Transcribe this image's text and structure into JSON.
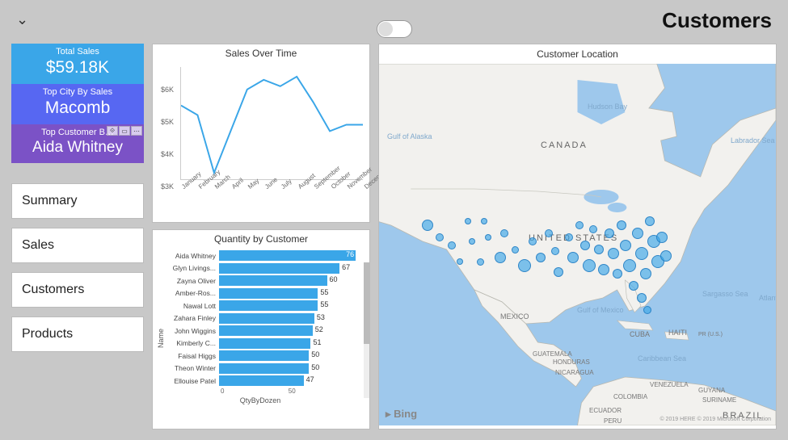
{
  "header": {
    "page_title": "Customers"
  },
  "cards": {
    "total_sales": {
      "label": "Total Sales",
      "value": "$59.18K"
    },
    "top_city": {
      "label": "Top City By Sales",
      "value": "Macomb"
    },
    "top_customer": {
      "label": "Top Customer B…",
      "value": "Aida Whitney"
    }
  },
  "nav": {
    "items": [
      "Summary",
      "Sales",
      "Customers",
      "Products"
    ]
  },
  "map": {
    "title": "Customer Location",
    "provider": "Bing",
    "attribution": "© 2019 HERE © 2019 Microsoft Corporation",
    "labels": {
      "canada": "CANADA",
      "us": "UNITED STATES",
      "mexico": "MEXICO",
      "brazil": "BRAZIL",
      "hudson": "Hudson Bay",
      "gulfmex": "Gulf of Mexico",
      "sargasso": "Sargasso Sea",
      "caribbean": "Caribbean Sea",
      "labrador": "Labrador Sea",
      "gulfak": "Gulf of Alaska",
      "atlantic": "Atlant\nOcea",
      "cuba": "CUBA",
      "haiti": "HAITI",
      "pr": "PR (U.S.)",
      "guatemala": "GUATEMALA",
      "honduras": "HONDURAS",
      "nicaragua": "NICARAGUA",
      "venezuela": "VENEZUELA",
      "colombia": "COLOMBIA",
      "guyana": "GUYANA",
      "suriname": "SURINAME",
      "ecuador": "ECUADOR",
      "peru": "PERU"
    }
  },
  "chart_data": [
    {
      "type": "line",
      "title": "Sales Over Time",
      "xlabel": "",
      "ylabel": "",
      "ylim": [
        3000,
        6500
      ],
      "y_ticks": [
        "$3K",
        "$4K",
        "$5K",
        "$6K"
      ],
      "categories": [
        "January",
        "February",
        "March",
        "April",
        "May",
        "June",
        "July",
        "August",
        "September",
        "October",
        "November",
        "December"
      ],
      "values": [
        5300,
        5000,
        3200,
        4500,
        5800,
        6100,
        5900,
        6200,
        5400,
        4500,
        4700,
        4700
      ]
    },
    {
      "type": "bar",
      "title": "Quantity by Customer",
      "xlabel": "QtyByDozen",
      "ylabel": "Name",
      "xlim": [
        0,
        80
      ],
      "x_ticks": [
        "0",
        "50"
      ],
      "categories": [
        "Aida Whitney",
        "Glyn Livings...",
        "Zayna Oliver",
        "Amber-Ros...",
        "Nawal Lott",
        "Zahara Finley",
        "John Wiggins",
        "Kimberly C...",
        "Faisal Higgs",
        "Theon Winter",
        "Ellouise Patel"
      ],
      "values": [
        76,
        67,
        60,
        55,
        55,
        53,
        52,
        51,
        50,
        50,
        47
      ]
    }
  ]
}
